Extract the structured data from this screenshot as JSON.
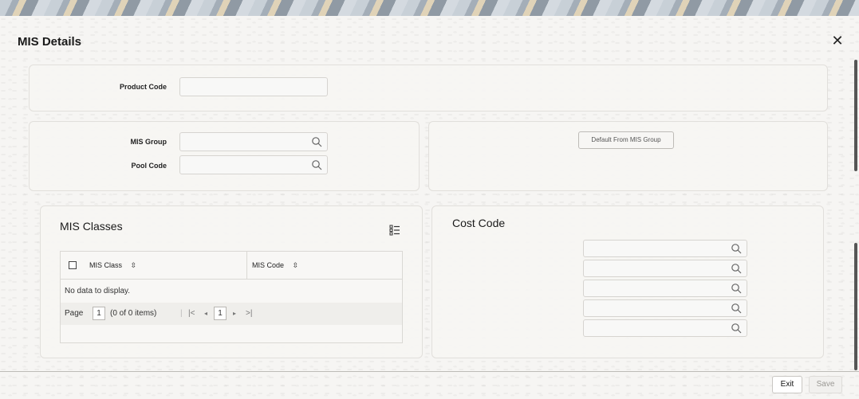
{
  "dialog": {
    "title": "MIS Details",
    "close_icon": "close-icon"
  },
  "product": {
    "label": "Product Code",
    "value": ""
  },
  "mis_group": {
    "group_label": "MIS Group",
    "group_value": "",
    "pool_label": "Pool Code",
    "pool_value": "",
    "default_button": "Default From MIS Group"
  },
  "mis_classes": {
    "title": "MIS Classes",
    "columns": [
      "MIS Class",
      "MIS Code"
    ],
    "empty_text": "No data to display.",
    "pager": {
      "page_label": "Page",
      "page_value": "1",
      "items_text": "(0 of 0 items)",
      "current_page": "1"
    }
  },
  "cost_code": {
    "title": "Cost Code",
    "fields": [
      "",
      "",
      "",
      "",
      ""
    ]
  },
  "footer": {
    "exit_label": "Exit",
    "save_label": "Save"
  }
}
